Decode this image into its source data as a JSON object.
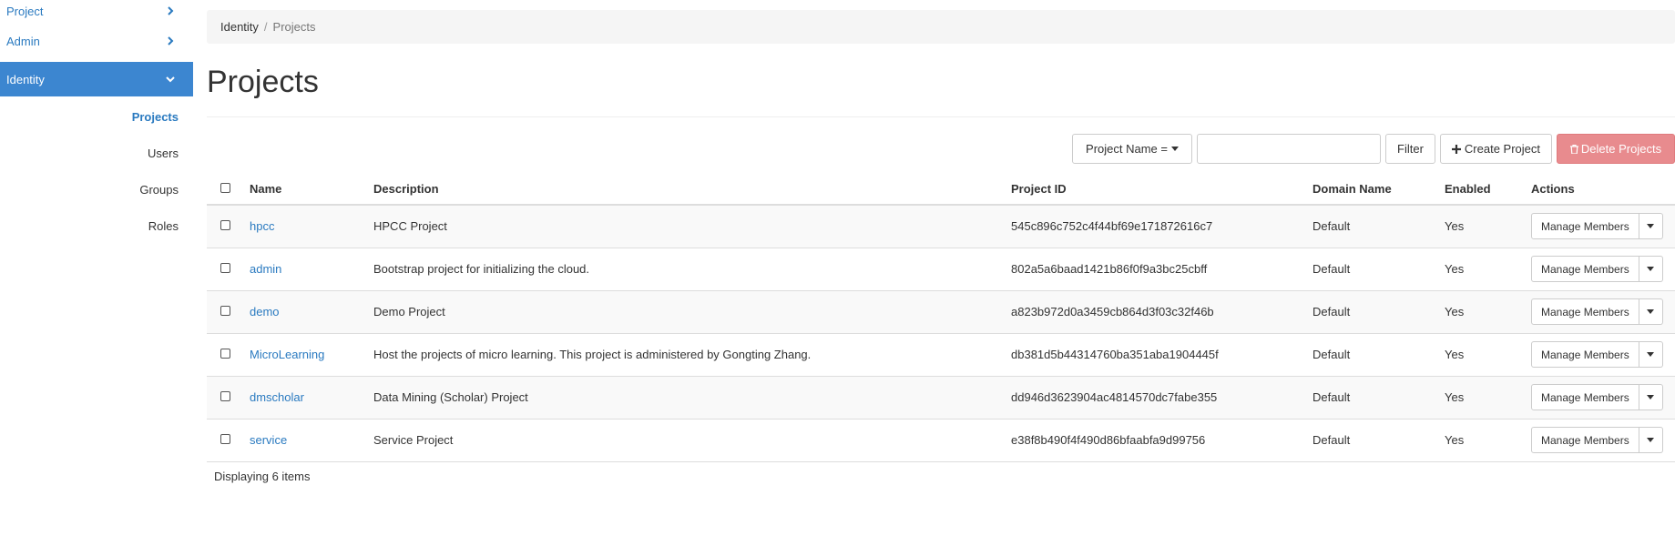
{
  "sidebar": {
    "items": [
      {
        "label": "Project"
      },
      {
        "label": "Admin"
      },
      {
        "label": "Identity"
      }
    ],
    "subitems": [
      {
        "label": "Projects"
      },
      {
        "label": "Users"
      },
      {
        "label": "Groups"
      },
      {
        "label": "Roles"
      }
    ]
  },
  "breadcrumb": {
    "parent": "Identity",
    "separator": "/",
    "current": "Projects"
  },
  "page": {
    "title": "Projects"
  },
  "actions": {
    "filter_select": "Project Name =",
    "search_value": "",
    "search_placeholder": "",
    "filter_label": "Filter",
    "create_label": "Create Project",
    "delete_label": "Delete Projects"
  },
  "table": {
    "headers": {
      "name": "Name",
      "description": "Description",
      "project_id": "Project ID",
      "domain_name": "Domain Name",
      "enabled": "Enabled",
      "actions": "Actions"
    },
    "rows": [
      {
        "name": "hpcc",
        "description": "HPCC Project",
        "project_id": "545c896c752c4f44bf69e171872616c7",
        "domain_name": "Default",
        "enabled": "Yes",
        "action": "Manage Members"
      },
      {
        "name": "admin",
        "description": "Bootstrap project for initializing the cloud.",
        "project_id": "802a5a6baad1421b86f0f9a3bc25cbff",
        "domain_name": "Default",
        "enabled": "Yes",
        "action": "Manage Members"
      },
      {
        "name": "demo",
        "description": "Demo Project",
        "project_id": "a823b972d0a3459cb864d3f03c32f46b",
        "domain_name": "Default",
        "enabled": "Yes",
        "action": "Manage Members"
      },
      {
        "name": "MicroLearning",
        "description": "Host the projects of micro learning. This project is administered by Gongting Zhang.",
        "project_id": "db381d5b44314760ba351aba1904445f",
        "domain_name": "Default",
        "enabled": "Yes",
        "action": "Manage Members"
      },
      {
        "name": "dmscholar",
        "description": "Data Mining (Scholar) Project",
        "project_id": "dd946d3623904ac4814570dc7fabe355",
        "domain_name": "Default",
        "enabled": "Yes",
        "action": "Manage Members"
      },
      {
        "name": "service",
        "description": "Service Project",
        "project_id": "e38f8b490f4f490d86bfaabfa9d99756",
        "domain_name": "Default",
        "enabled": "Yes",
        "action": "Manage Members"
      }
    ],
    "footer": "Displaying 6 items"
  },
  "colors": {
    "accent": "#3c86d0",
    "link": "#2a7ac0",
    "danger": "#e88b8e"
  }
}
